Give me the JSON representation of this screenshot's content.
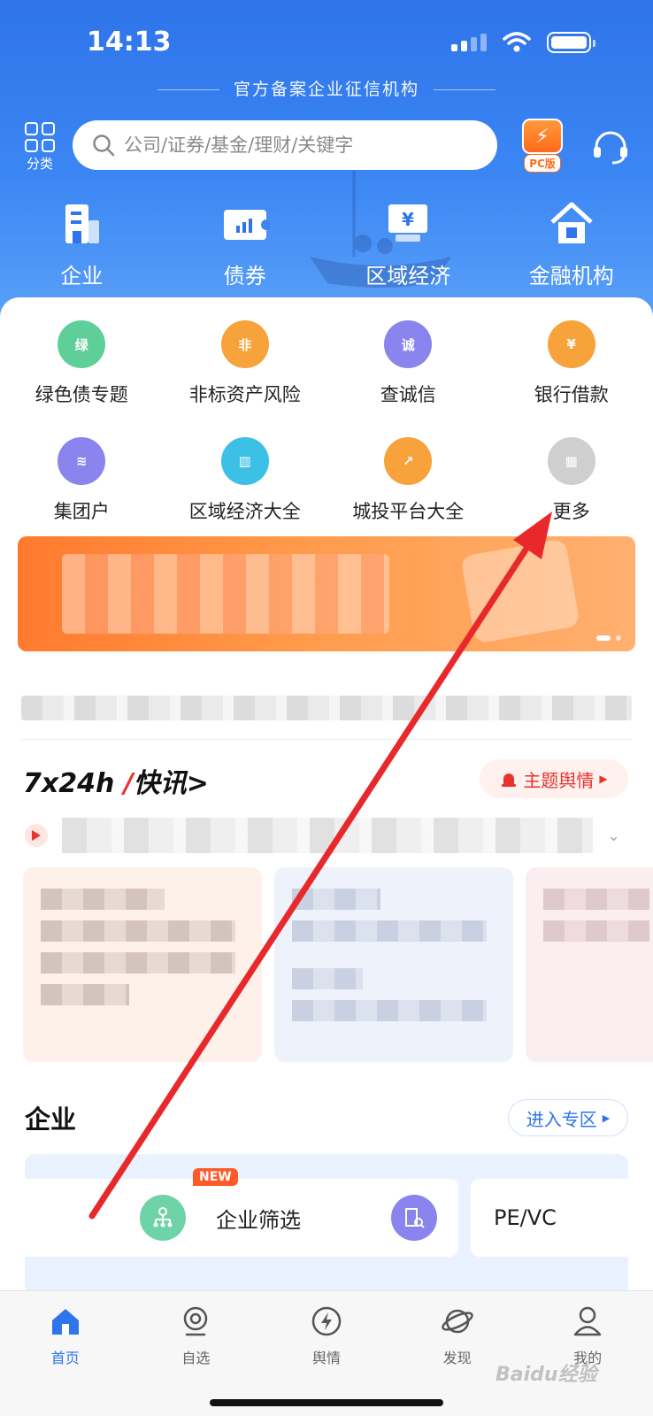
{
  "status_bar": {
    "time": "14:13"
  },
  "header": {
    "tagline": "官方备案企业征信机构",
    "category_label": "分类",
    "search_placeholder": "公司/证券/基金/理财/关键字",
    "pc_label": "PC版"
  },
  "main_nav": [
    {
      "label": "企业",
      "icon": "building-icon"
    },
    {
      "label": "债券",
      "icon": "bond-ticket-icon"
    },
    {
      "label": "区域经济",
      "icon": "yen-board-icon"
    },
    {
      "label": "金融机构",
      "icon": "bank-house-icon"
    }
  ],
  "quick_items": [
    {
      "label": "绿色债专题",
      "icon": "green-bond-icon",
      "glyph": "绿",
      "color": "#5fcf99"
    },
    {
      "label": "非标资产风险",
      "icon": "shield-icon",
      "glyph": "非",
      "color": "#f7a23a"
    },
    {
      "label": "查诚信",
      "icon": "magnifier-icon",
      "glyph": "诚",
      "color": "#8a84ef"
    },
    {
      "label": "银行借款",
      "icon": "money-bag-icon",
      "glyph": "¥",
      "color": "#f7a23a"
    },
    {
      "label": "集团户",
      "icon": "layers-icon",
      "glyph": "≋",
      "color": "#8a84ef"
    },
    {
      "label": "区域经济大全",
      "icon": "bar-chart-icon",
      "glyph": "▥",
      "color": "#3cc0e6"
    },
    {
      "label": "城投平台大全",
      "icon": "trend-chart-icon",
      "glyph": "↗",
      "color": "#f7a23a"
    },
    {
      "label": "更多",
      "icon": "more-grid-icon",
      "glyph": "▦",
      "color": "#cfcfcf"
    }
  ],
  "flash": {
    "title_prefix": "7x24h ",
    "title_main": "快讯",
    "chevron": ">",
    "topic_button": "主题舆情"
  },
  "enterprise": {
    "title": "企业",
    "enter_button": "进入专区",
    "new_badge": "NEW",
    "tiles": [
      "企业筛选",
      "PE/VC"
    ]
  },
  "tabbar": [
    {
      "label": "首页",
      "icon": "home-icon",
      "active": true
    },
    {
      "label": "自选",
      "icon": "webcam-icon",
      "active": false
    },
    {
      "label": "舆情",
      "icon": "lightning-icon",
      "active": false
    },
    {
      "label": "发现",
      "icon": "planet-icon",
      "active": false
    },
    {
      "label": "我的",
      "icon": "person-icon",
      "active": false
    }
  ],
  "watermark": "Baidu经验",
  "colors": {
    "brand_blue": "#2f74ea",
    "accent_red": "#e8342f",
    "accent_orange": "#ff6a1a"
  }
}
